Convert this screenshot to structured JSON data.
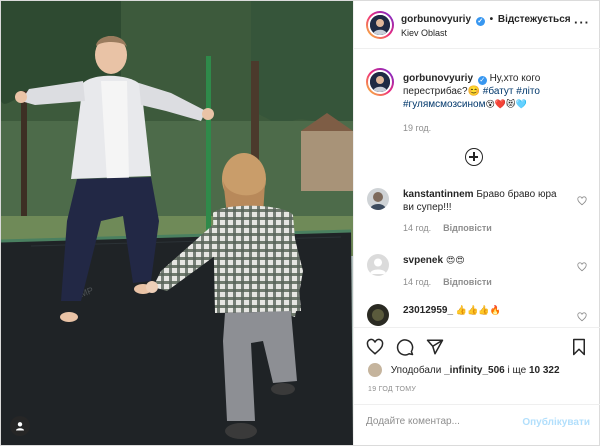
{
  "header": {
    "username": "gorbunovyuriy",
    "separator": "•",
    "follow_label": "Відстежується",
    "location": "Kiev Oblast",
    "more_icon": "more-horizontal-icon",
    "verified_icon": "verified-badge-icon"
  },
  "caption": {
    "username": "gorbunovyuriy",
    "text": "Ну,хто кого перестрибає?😊",
    "hashtags": [
      "#батут",
      "#літо",
      "#гулямсмозсином"
    ],
    "emojis": "😵❤️😻🩵",
    "time": "19 год."
  },
  "load_more_icon": "plus-circle-icon",
  "comments": [
    {
      "username": "kanstantinnem",
      "text": "Браво браво юра ви супер!!!",
      "time": "14 год.",
      "reply": "Відповісти"
    },
    {
      "username": "svpenek",
      "text": "😍😍",
      "time": "14 год.",
      "reply": "Відповісти"
    },
    {
      "username": "23012959_",
      "text": "👍👍👍🔥",
      "time": "",
      "reply": ""
    }
  ],
  "actions": {
    "like_icon": "heart-icon",
    "comment_icon": "comment-icon",
    "share_icon": "paper-plane-icon",
    "save_icon": "bookmark-icon"
  },
  "likes": {
    "prefix": "Уподобали",
    "user": "_infinity_506",
    "mid": "і ще",
    "count": "10 322"
  },
  "timestamp": "19 ГОД ТОМУ",
  "add_comment": {
    "placeholder": "Додайте коментар...",
    "post_label": "Опублікувати"
  },
  "colors": {
    "tag": "#00376b",
    "verified": "#3897f0",
    "post_disabled": "#b2dffc",
    "meta": "#8e8e8e"
  }
}
